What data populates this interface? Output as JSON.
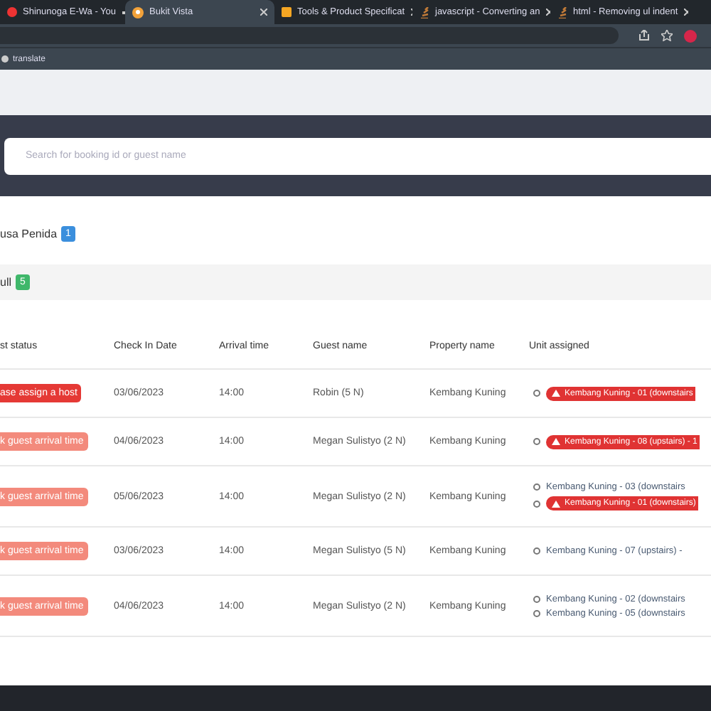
{
  "browser": {
    "tabs": [
      {
        "title": "Shinunoga E-Wa - You",
        "selected": false,
        "kind": "media"
      },
      {
        "title": "Bukit Vista",
        "selected": true,
        "kind": "site"
      },
      {
        "title": "Tools & Product Specificat",
        "selected": false,
        "kind": "doc"
      },
      {
        "title": "javascript - Converting an",
        "selected": false,
        "kind": "stack"
      },
      {
        "title": "html - Removing ul indent",
        "selected": false,
        "kind": "stack"
      }
    ],
    "bookmark": "translate"
  },
  "search": {
    "placeholder": "Search for booking id or guest name"
  },
  "groups": [
    {
      "label": "usa Penida",
      "count": "1",
      "color": "#3b8fdd"
    },
    {
      "label": "ull",
      "count": "5",
      "color": "#3fb76a"
    }
  ],
  "table": {
    "columns": [
      "st status",
      "Check In Date",
      "Arrival time",
      "Guest name",
      "Property name",
      "Unit assigned"
    ],
    "rows": [
      {
        "status": "ase assign a host",
        "color": "#e53935",
        "date": "03/06/2023",
        "time": "14:00",
        "guest": "Robin (5 N)",
        "property": "Kembang Kuning",
        "units": [
          {
            "text": "Kembang Kuning - 01 (downstairs",
            "alert": true
          }
        ]
      },
      {
        "status": "k guest arrival time",
        "color": "#f38a7c",
        "date": "04/06/2023",
        "time": "14:00",
        "guest": "Megan Sulistyo (2 N)",
        "property": "Kembang Kuning",
        "units": [
          {
            "text": "Kembang Kuning - 08 (upstairs) - 1",
            "alert": true
          }
        ]
      },
      {
        "status": "k guest arrival time",
        "color": "#f38a7c",
        "date": "05/06/2023",
        "time": "14:00",
        "guest": "Megan Sulistyo (2 N)",
        "property": "Kembang Kuning",
        "units": [
          {
            "text": "Kembang Kuning - 03 (downstairs",
            "alert": false
          },
          {
            "text": "Kembang Kuning - 01 (downstairs)",
            "alert": true
          }
        ]
      },
      {
        "status": "k guest arrival time",
        "color": "#f38a7c",
        "date": "03/06/2023",
        "time": "14:00",
        "guest": "Megan Sulistyo (5 N)",
        "property": "Kembang Kuning",
        "units": [
          {
            "text": "Kembang Kuning - 07 (upstairs) -",
            "alert": false
          }
        ]
      },
      {
        "status": "k guest arrival time",
        "color": "#f38a7c",
        "date": "04/06/2023",
        "time": "14:00",
        "guest": "Megan Sulistyo (2 N)",
        "property": "Kembang Kuning",
        "units": [
          {
            "text": "Kembang Kuning - 02 (downstairs",
            "alert": false
          },
          {
            "text": "Kembang Kuning - 05 (downstairs",
            "alert": false
          }
        ]
      }
    ]
  }
}
